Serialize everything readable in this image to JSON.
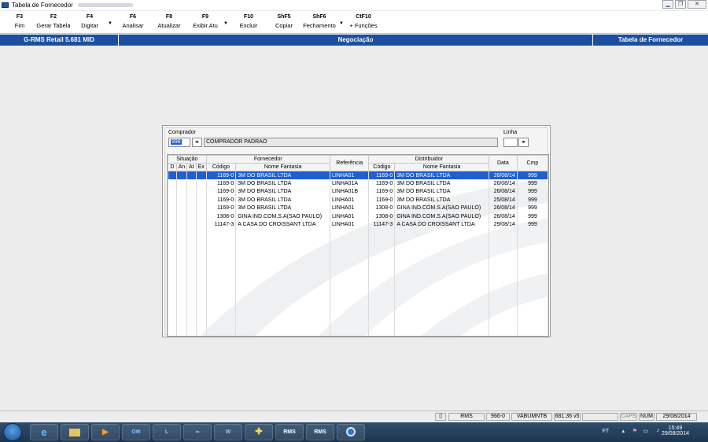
{
  "window": {
    "title": "Tabela de Fornecedor",
    "controls": [
      "▁",
      "❐",
      "✕"
    ]
  },
  "toolbar": {
    "buttons": [
      {
        "key": "F3",
        "label": "Fim"
      },
      {
        "key": "F2",
        "label": "Gerar Tabela"
      },
      {
        "key": "F4",
        "label": "Digitar"
      },
      {
        "key": "F6",
        "label": "Analisar"
      },
      {
        "key": "F8",
        "label": "Atualizar"
      },
      {
        "key": "F9",
        "label": "Exibir Atu"
      },
      {
        "key": "F10",
        "label": "Excluir"
      },
      {
        "key": "ShF5",
        "label": "Copiar"
      },
      {
        "key": "ShF6",
        "label": "Fechamento"
      },
      {
        "key": "CtF10",
        "label": "+ Funções"
      }
    ]
  },
  "header": {
    "left": "G-RMS Retail 5.681 MID",
    "center": "Negociação",
    "right": "Tabela de Fornecedor"
  },
  "form": {
    "comprador_label": "Comprador",
    "comprador_code": "998",
    "comprador_name": "COMPRADOR PADRAO",
    "linha_label": "Linha",
    "linha_value": ""
  },
  "grid": {
    "group_headers": {
      "situacao": "Situação",
      "fornecedor": "Fornecedor",
      "referencia": "Referência",
      "distribuidor": "Distribuidor",
      "data": "Data",
      "cmp": "Cmp"
    },
    "sub_headers": {
      "d": "D",
      "an": "An",
      "at": "At",
      "ex": "Ex",
      "forn_codigo": "Código",
      "forn_nome": "Nome Fantasia",
      "dist_codigo": "Código",
      "dist_nome": "Nome Fantasia"
    },
    "rows": [
      {
        "forn_codigo": "1169-0",
        "forn_nome": "3M DO BRASIL LTDA",
        "referencia": "LINHA01",
        "dist_codigo": "1169-0",
        "dist_nome": "3M DO BRASIL LTDA",
        "data": "26/08/14",
        "cmp": "999"
      },
      {
        "forn_codigo": "1169-0",
        "forn_nome": "3M DO BRASIL LTDA",
        "referencia": "LINHA01A",
        "dist_codigo": "1169-0",
        "dist_nome": "3M DO BRASIL LTDA",
        "data": "26/08/14",
        "cmp": "999"
      },
      {
        "forn_codigo": "1169-0",
        "forn_nome": "3M DO BRASIL LTDA",
        "referencia": "LINHA01B",
        "dist_codigo": "1169-0",
        "dist_nome": "3M DO BRASIL LTDA",
        "data": "26/08/14",
        "cmp": "999"
      },
      {
        "forn_codigo": "1169-0",
        "forn_nome": "3M DO BRASIL LTDA",
        "referencia": "LINHA01",
        "dist_codigo": "1169-0",
        "dist_nome": "3M DO BRASIL LTDA",
        "data": "25/08/14",
        "cmp": "999"
      },
      {
        "forn_codigo": "1169-0",
        "forn_nome": "3M DO BRASIL LTDA",
        "referencia": "LINHA01",
        "dist_codigo": "1308-0",
        "dist_nome": "GINA IND.COM.S.A(SAO PAULO)",
        "data": "26/08/14",
        "cmp": "999"
      },
      {
        "forn_codigo": "1308-0",
        "forn_nome": "GINA IND.COM.S.A(SAO PAULO)",
        "referencia": "LINHA01",
        "dist_codigo": "1308-0",
        "dist_nome": "GINA IND.COM.S.A(SAO PAULO)",
        "data": "26/08/14",
        "cmp": "999"
      },
      {
        "forn_codigo": "11147-3",
        "forn_nome": "A CASA DO CROISSANT LTDA",
        "referencia": "LINHA01",
        "dist_codigo": "11147-3",
        "dist_nome": "A CASA DO CROISSANT LTDA",
        "data": "29/08/14",
        "cmp": "999"
      }
    ],
    "selected_row": 0
  },
  "statusbar": {
    "app": "RMS",
    "code": "966-0",
    "user": "VABUMNTB",
    "version": "681.36 v5",
    "caps": "CAPS",
    "num": "NUM",
    "date": "29/08/2014"
  },
  "taskbar": {
    "items": [
      "ie",
      "explorer",
      "media",
      "outlook",
      "lync",
      "app",
      "word",
      "plus",
      "RMS",
      "RMS",
      "chrome"
    ],
    "tray_lang": "FT",
    "time": "15:49",
    "date": "29/08/2014"
  },
  "colors": {
    "header_blue": "#1d4fa0",
    "selection_blue": "#1f5fd0",
    "taskbar": "#1c3450"
  }
}
